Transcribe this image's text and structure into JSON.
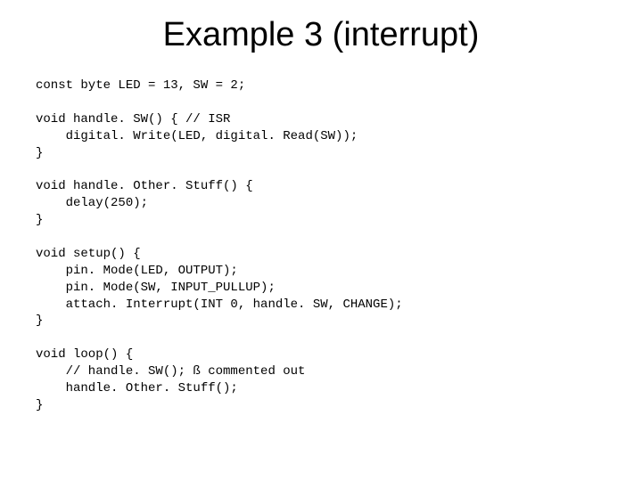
{
  "title": "Example 3 (interrupt)",
  "code": {
    "l01": "const byte LED = 13, SW = 2;",
    "l02": "",
    "l03": "void handle. SW() { // ISR",
    "l04": "    digital. Write(LED, digital. Read(SW));",
    "l05": "}",
    "l06": "",
    "l07": "void handle. Other. Stuff() {",
    "l08": "    delay(250);",
    "l09": "}",
    "l10": "",
    "l11": "void setup() {",
    "l12": "    pin. Mode(LED, OUTPUT);",
    "l13": "    pin. Mode(SW, INPUT_PULLUP);",
    "l14": "    attach. Interrupt(INT 0, handle. SW, CHANGE);",
    "l15": "}",
    "l16": "",
    "l17": "void loop() {",
    "l18": "    // handle. SW(); ß commented out",
    "l19": "    handle. Other. Stuff();",
    "l20": "}"
  }
}
